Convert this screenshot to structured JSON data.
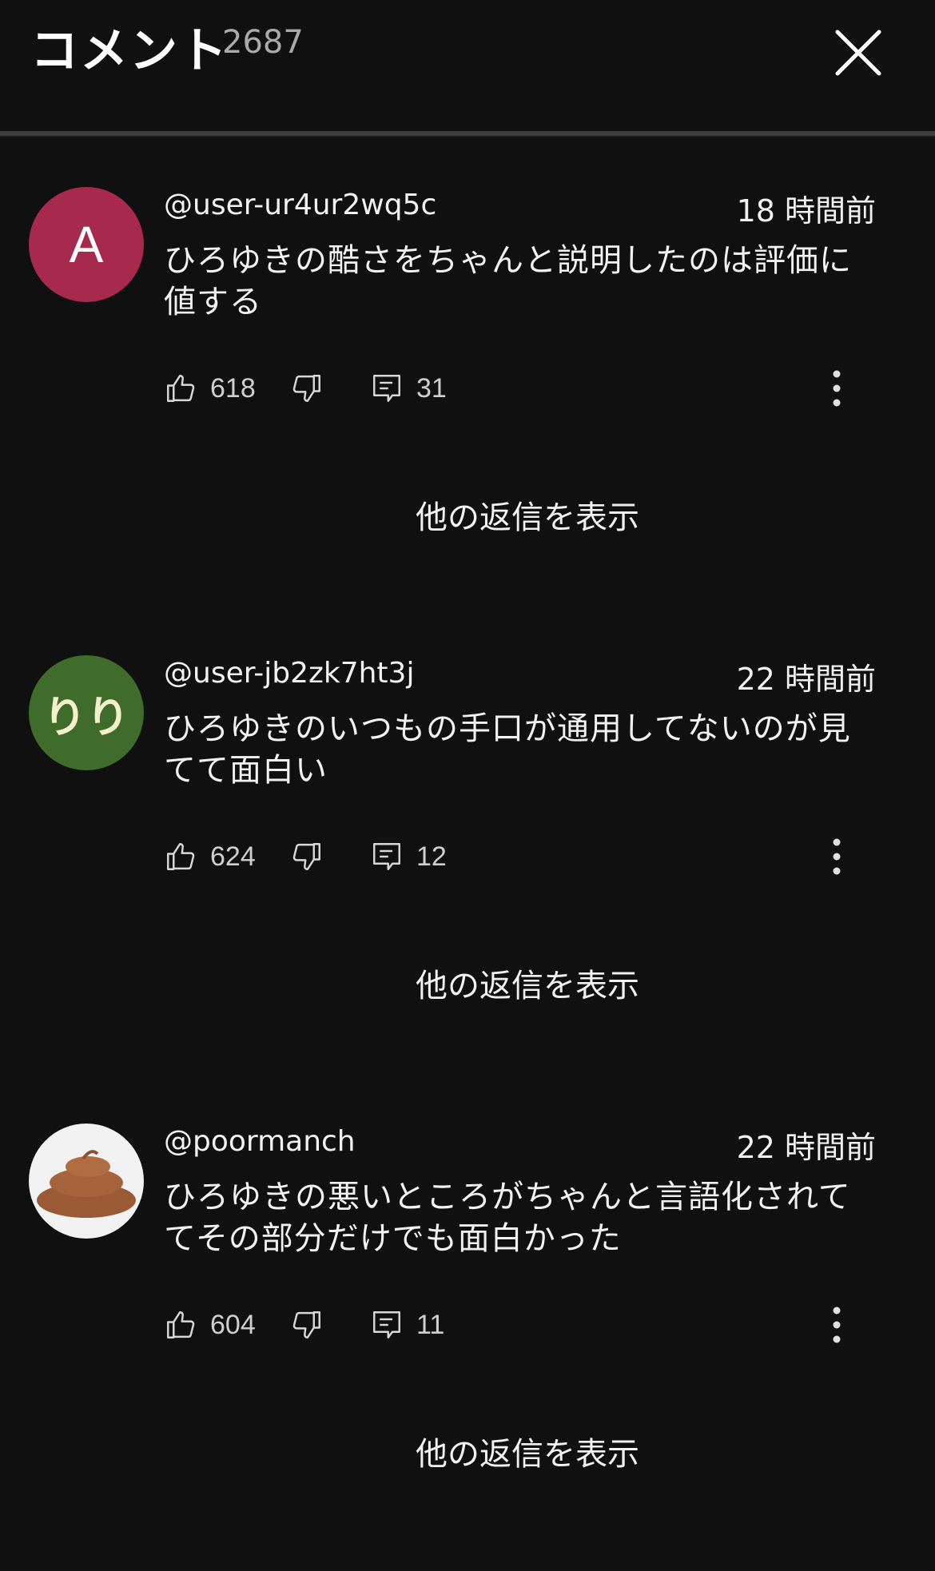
{
  "header": {
    "title": "コメント",
    "count": "2687"
  },
  "comments": [
    {
      "avatar_letter": "A",
      "avatar_color": "#a8294e",
      "handle": "@user-ur4ur2wq5c",
      "time": "18 時間前",
      "text": "ひろゆきの酷さをちゃんと説明したのは評価に値する",
      "likes": "618",
      "replies": "31",
      "show_replies_label": "他の返信を表示"
    },
    {
      "avatar_letter": "りり",
      "avatar_color": "#3f6b2b",
      "handle": "@user-jb2zk7ht3j",
      "time": "22 時間前",
      "text": "ひろゆきのいつもの手口が通用してないのが見てて面白い",
      "likes": "624",
      "replies": "12",
      "show_replies_label": "他の返信を表示"
    },
    {
      "avatar_icon": "poop-icon",
      "avatar_color": "#f2f2f2",
      "handle": "@poormanch",
      "time": "22 時間前",
      "text": "ひろゆきの悪いところがちゃんと言語化されててその部分だけでも面白かった",
      "likes": "604",
      "replies": "11",
      "show_replies_label": "他の返信を表示"
    }
  ],
  "icons": {
    "close": "close-icon",
    "like": "thumbs-up-icon",
    "dislike": "thumbs-down-icon",
    "reply": "comment-icon",
    "more": "more-vertical-icon"
  }
}
